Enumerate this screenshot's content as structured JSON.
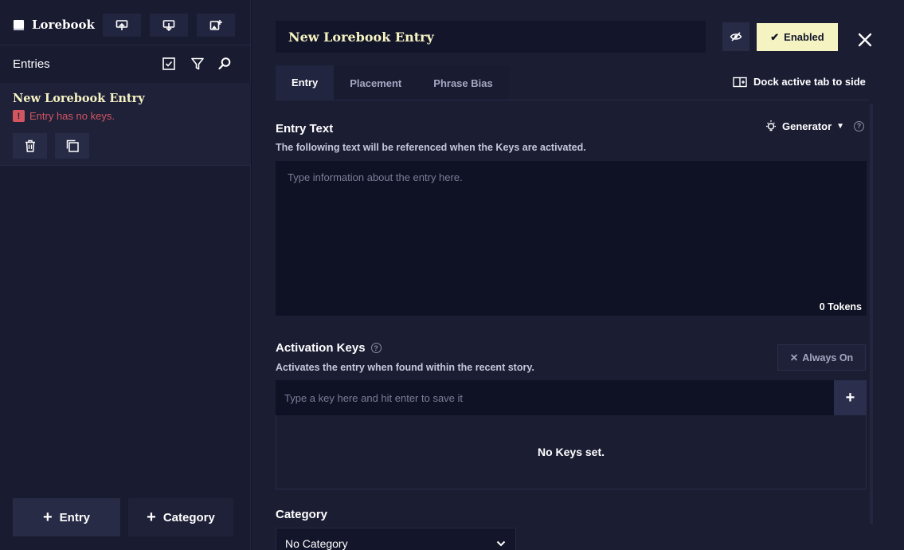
{
  "sidebar": {
    "title": "Lorebook",
    "entries_label": "Entries",
    "entry": {
      "title": "New Lorebook Entry",
      "warning": "Entry has no keys."
    },
    "add_entry_label": "Entry",
    "add_category_label": "Category"
  },
  "editor": {
    "entry_title": "New Lorebook Entry",
    "enabled_label": "Enabled",
    "tabs": [
      {
        "label": "Entry",
        "active": true
      },
      {
        "label": "Placement",
        "active": false
      },
      {
        "label": "Phrase Bias",
        "active": false
      }
    ],
    "dock_label": "Dock active tab to side",
    "entry_text": {
      "title": "Entry Text",
      "description": "The following text will be referenced when the Keys are activated.",
      "placeholder": "Type information about the entry here.",
      "tokens": "0 Tokens",
      "generator_label": "Generator"
    },
    "activation_keys": {
      "title": "Activation Keys",
      "description": "Activates the entry when found within the recent story.",
      "always_on_label": "Always On",
      "input_placeholder": "Type a key here and hit enter to save it",
      "empty_text": "No Keys set."
    },
    "category": {
      "title": "Category",
      "selected": "No Category"
    }
  },
  "colors": {
    "background": "#13152a",
    "sidebar": "#191b31",
    "panel": "#1b1d33",
    "accent": "#f5f3c2",
    "warning": "#d3555f",
    "muted_text": "#a4a7c1"
  }
}
